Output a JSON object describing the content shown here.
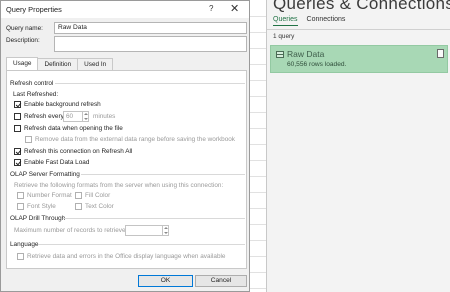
{
  "dialog": {
    "title": "Query Properties",
    "help": "?",
    "close": "✕",
    "query_name_label": "Query name:",
    "query_name_value": "Raw Data",
    "description_label": "Description:",
    "tabs": [
      "Usage",
      "Definition",
      "Used In"
    ],
    "refresh_control": {
      "heading": "Refresh control",
      "last_refreshed": "Last Refreshed:",
      "enable_background": "Enable background refresh",
      "refresh_every": "Refresh every",
      "refresh_every_value": "60",
      "minutes": "minutes",
      "refresh_on_open": "Refresh data when opening the file",
      "remove_data": "Remove data from the external data range before saving the workbook",
      "refresh_all": "Refresh this connection on Refresh All",
      "fast_load": "Enable Fast Data Load"
    },
    "olap_formatting": {
      "heading": "OLAP Server Formatting",
      "retrieve_text": "Retrieve the following formats from the server when using this connection:",
      "number_format": "Number Format",
      "fill_color": "Fill Color",
      "font_style": "Font Style",
      "text_color": "Text Color"
    },
    "olap_drill": {
      "heading": "OLAP Drill Through",
      "max_records": "Maximum number of records to retrieve:"
    },
    "language": {
      "heading": "Language",
      "retrieve_lang": "Retrieve data and errors in the Office display language when available"
    },
    "ok": "OK",
    "cancel": "Cancel"
  },
  "pane": {
    "title": "Queries & Connections",
    "tabs": [
      "Queries",
      "Connections"
    ],
    "count": "1 query",
    "query_name": "Raw Data",
    "query_rows": "60,556 rows loaded."
  },
  "colors": {
    "accent": "#217346",
    "card": "#a8d8b5",
    "ok_border": "#0078d7"
  }
}
